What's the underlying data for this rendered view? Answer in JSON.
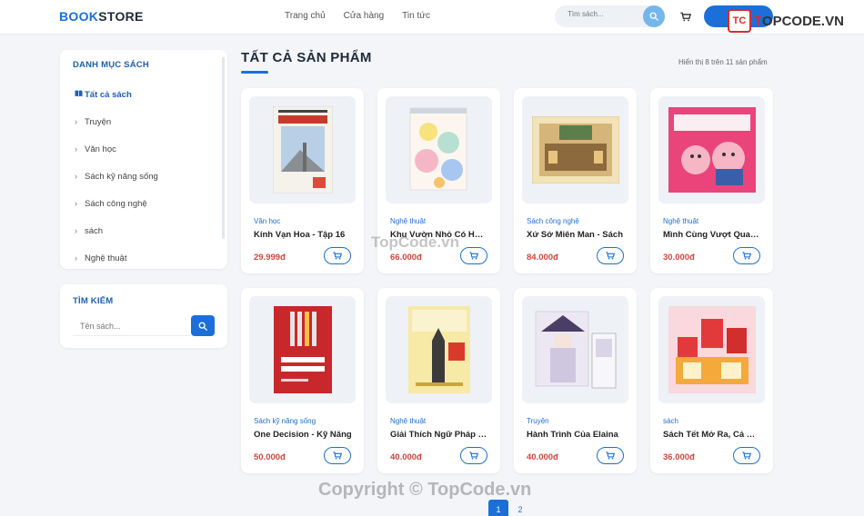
{
  "header": {
    "logo_bold": "BOOK",
    "logo_rest": "STORE",
    "nav": [
      "Trang chủ",
      "Cửa hàng",
      "Tin tức"
    ],
    "search_placeholder": "Tìm sách...",
    "login_label": "Đăng"
  },
  "watermark": {
    "brand_badge": "TC",
    "brand_left": "T",
    "brand_right": "OPCODE.VN",
    "center": "TopCode.vn",
    "bottom": "Copyright © TopCode.vn"
  },
  "sidebar": {
    "categories_title": "DANH MỤC SÁCH",
    "categories": [
      {
        "label": "Tất cả sách",
        "active": true
      },
      {
        "label": "Truyện"
      },
      {
        "label": "Văn học"
      },
      {
        "label": "Sách kỹ năng sống"
      },
      {
        "label": "Sách công nghệ"
      },
      {
        "label": "sách"
      },
      {
        "label": "Nghệ thuật"
      }
    ],
    "search_title": "TÌM KIẾM",
    "search_placeholder": "Tên sách..."
  },
  "main": {
    "title": "TẤT CẢ SẢN PHẨM",
    "result_info": "Hiển thị 8 trên 11 sản phẩm",
    "products": [
      {
        "category": "Văn học",
        "name": "Kính Vạn Hoa - Tập 16",
        "price": "29.999đ",
        "cover": "kinh-van-hoa"
      },
      {
        "category": "Nghệ thuật",
        "name": "Khu Vườn Nhỏ Có Hoa Cỏ",
        "price": "66.000đ",
        "cover": "khu-vuon"
      },
      {
        "category": "Sách công nghệ",
        "name": "Xứ Sở Miên Man - Sách",
        "price": "84.000đ",
        "cover": "xu-so"
      },
      {
        "category": "Nghệ thuật",
        "name": "Mình Cùng Vượt Qua Lo Kỳ Cục",
        "price": "30.000đ",
        "cover": "tuti"
      },
      {
        "category": "Sách kỹ năng sống",
        "name": "One Decision - Kỹ Năng",
        "price": "50.000đ",
        "cover": "one-decision"
      },
      {
        "category": "Nghệ thuật",
        "name": "Giải Thích Ngữ Pháp Tiếng Anh",
        "price": "40.000đ",
        "cover": "ngu-phap"
      },
      {
        "category": "Truyện",
        "name": "Hành Trình Của Elaina",
        "price": "40.000đ",
        "cover": "elaina"
      },
      {
        "category": "sách",
        "name": "Sách Tết Mở Ra, Cả Nhà",
        "price": "36.000đ",
        "cover": "tet"
      }
    ]
  },
  "pagination": {
    "pages": [
      "1",
      "2"
    ],
    "active": "1"
  },
  "colors": {
    "accent": "#1c6fd8",
    "price": "#d6443c",
    "background": "#f3f5f9"
  }
}
